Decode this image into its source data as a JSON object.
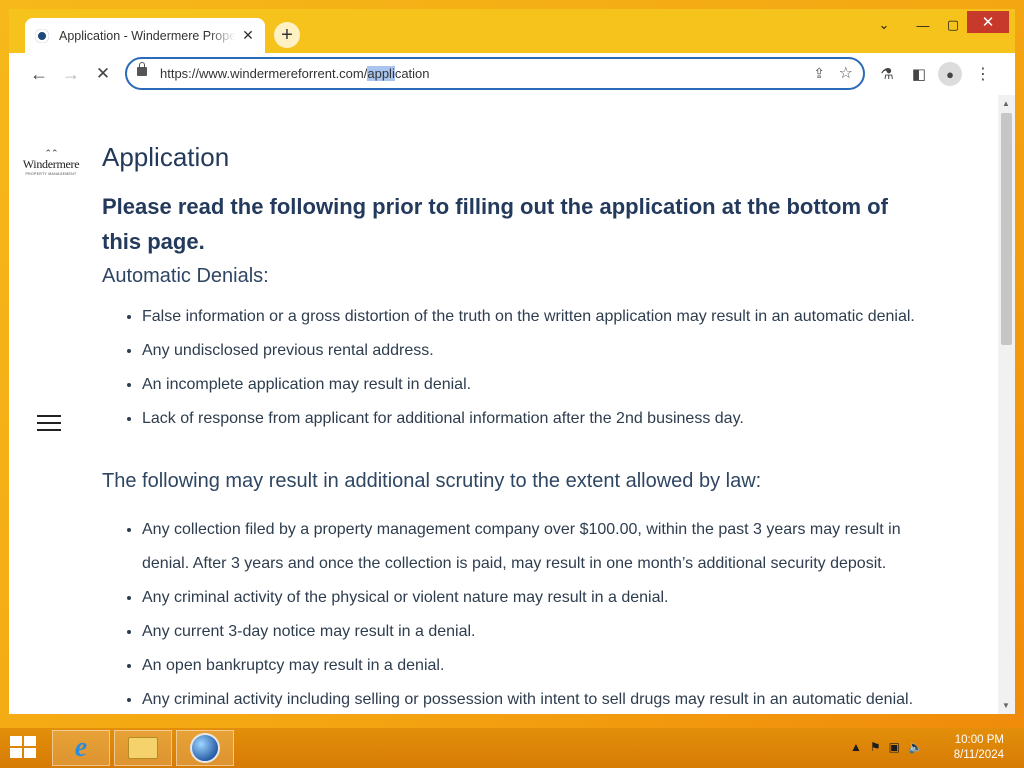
{
  "browser": {
    "tab_title": "Application - Windermere Prope",
    "tab_close": "✕",
    "new_tab": "+",
    "url_prefix": "https://www.windermereforrent.com/",
    "url_selected": "appli",
    "url_suffix": "cation",
    "window_controls": {
      "chevron": "⌄",
      "minimize": "—",
      "maximize": "▢",
      "close": "✕"
    }
  },
  "toolbar_icons": [
    "back-arrow",
    "forward-arrow",
    "stop-loading",
    "lock",
    "share",
    "bookmark-star",
    "lab-flask",
    "side-panel",
    "profile",
    "kebab-menu"
  ],
  "page": {
    "logo_text": "Windermere",
    "logo_subtext": "PROPERTY MANAGEMENT",
    "title": "Application",
    "intro": "Please read the following prior to filling out the application at the bottom of this page.",
    "section1": {
      "heading": "Automatic Denials:",
      "items": [
        "False information or a gross distortion of the truth on the written application may result in an automatic denial.",
        "Any undisclosed previous rental address.",
        "An incomplete application may result in denial.",
        "Lack of response from applicant for additional information after the 2nd business day."
      ]
    },
    "section2": {
      "heading": "The following may result in additional scrutiny to the extent allowed by law:",
      "items": [
        "Any collection filed by a property management company over $100.00, within the past 3 years may result in denial. After 3 years and once the collection is paid, may result in one month’s additional security deposit.",
        "Any criminal activity of the physical or violent nature may result in a denial.",
        "Any current 3-day notice may result in a denial.",
        "An open bankruptcy may result in a denial.",
        "Any criminal activity including selling or possession with intent to sell drugs may result in an automatic denial."
      ]
    }
  },
  "taskbar": {
    "apps": [
      "internet-explorer",
      "file-explorer",
      "chrome"
    ],
    "time": "10:00 PM",
    "date": "8/11/2024"
  }
}
